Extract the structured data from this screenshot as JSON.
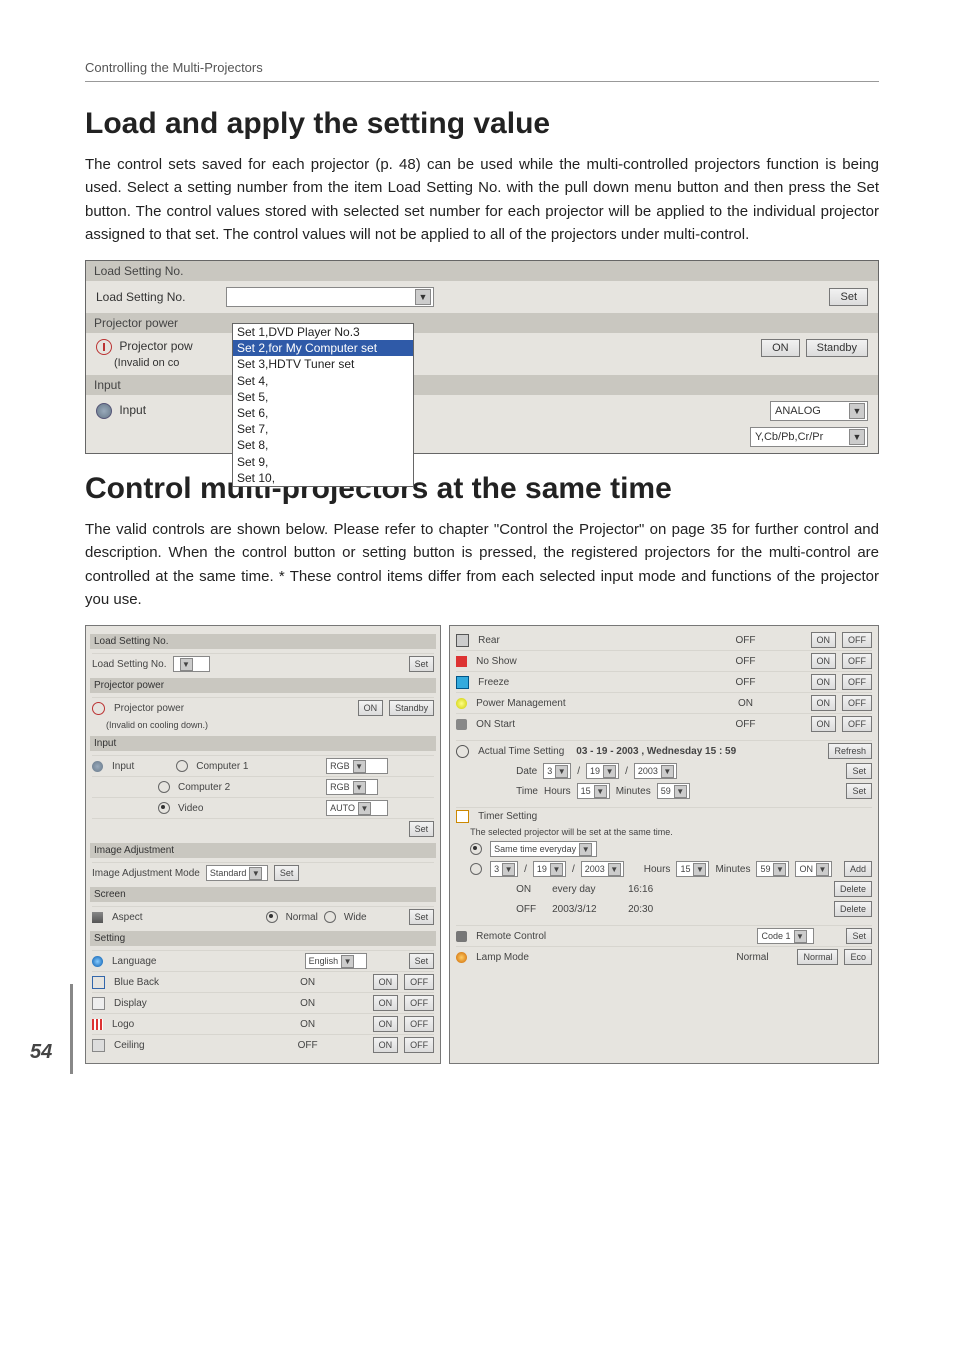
{
  "page": {
    "running_head": "Controlling the Multi-Projectors",
    "number": "54"
  },
  "section1": {
    "title": "Load and apply the setting value",
    "para": "The control sets saved for each projector (p. 48) can be used while the multi-controlled projectors function is being used. Select a setting number from the item Load Setting No. with the pull down menu button and then press the Set button. The control values stored with selected set number for each projector will be applied to the individual projector assigned to that set. The control values will not be applied to all of the projectors under multi-control."
  },
  "shot1": {
    "hdr": "Load Setting No.",
    "label_load": "Load Setting No.",
    "btn_set": "Set",
    "row_pp_hdr": "Projector power",
    "row_pp_label": "Projector pow",
    "pp_note": "(Invalid on co",
    "btn_on": "ON",
    "btn_standby": "Standby",
    "hdr_input": "Input",
    "label_input": "Input",
    "analog": "ANALOG",
    "ycbcr": "Y,Cb/Pb,Cr/Pr",
    "options": [
      "Set 1,DVD Player No.3",
      "Set 2,for My Computer set",
      "Set 3,HDTV Tuner set",
      "Set 4,",
      "Set 5,",
      "Set 6,",
      "Set 7,",
      "Set 8,",
      "Set 9,",
      "Set 10,"
    ]
  },
  "section2": {
    "title": "Control multi-projectors at the same time",
    "para": "The valid controls are shown below. Please refer to chapter \"Control the Projector\" on page 35 for further control and description. When the control button or setting button is pressed, the registered projectors for the multi-control are controlled at the same time. * These control items differ from each selected input mode and functions of the projector you use."
  },
  "left": {
    "hdr_load": "Load Setting No.",
    "lbl_load": "Load Setting No.",
    "btn_set": "Set",
    "hdr_pp": "Projector power",
    "lbl_pp": "Projector power",
    "note_pp": "(Invalid on cooling down.)",
    "on": "ON",
    "standby": "Standby",
    "hdr_input": "Input",
    "lbl_input": "Input",
    "comp1": "Computer 1",
    "comp2": "Computer 2",
    "video": "Video",
    "rgb": "RGB",
    "auto": "AUTO",
    "hdr_img": "Image Adjustment",
    "lbl_img": "Image Adjustment Mode",
    "img_val": "Standard",
    "hdr_screen": "Screen",
    "lbl_aspect": "Aspect",
    "asp_normal": "Normal",
    "asp_wide": "Wide",
    "hdr_setting": "Setting",
    "lbl_lang": "Language",
    "lang_val": "English",
    "lbl_blue": "Blue Back",
    "lbl_disp": "Display",
    "lbl_logo": "Logo",
    "lbl_ceil": "Ceiling",
    "val_on": "ON",
    "val_off": "OFF",
    "btn_on": "ON",
    "btn_off": "OFF"
  },
  "right": {
    "lbl_rear": "Rear",
    "lbl_noshow": "No Show",
    "lbl_freeze": "Freeze",
    "lbl_pm": "Power Management",
    "lbl_onstart": "ON Start",
    "val_off": "OFF",
    "val_on": "ON",
    "btn_on": "ON",
    "btn_off": "OFF",
    "lbl_ats": "Actual Time Setting",
    "ats_val": "03 - 19 - 2003 , Wednesday 15 : 59",
    "btn_refresh": "Refresh",
    "lbl_date": "Date",
    "d_m": "3",
    "d_d": "19",
    "d_y": "2003",
    "lbl_time": "Time",
    "lbl_hours": "Hours",
    "t_h": "15",
    "lbl_minutes": "Minutes",
    "t_m": "59",
    "btn_set": "Set",
    "lbl_timer": "Timer Setting",
    "timer_note": "The selected projector will be set at the same time.",
    "opt_same": "Same time everyday",
    "add": "Add",
    "del": "Delete",
    "t_on_v": "ON",
    "sched1_a": "ON",
    "sched1_b": "every day",
    "sched1_c": "16:16",
    "sched2_a": "OFF",
    "sched2_b": "2003/3/12",
    "sched2_c": "20:30",
    "lbl_rc": "Remote Control",
    "rc_val": "Code 1",
    "lbl_lamp": "Lamp Mode",
    "lamp_val": "Normal",
    "btn_normal": "Normal",
    "btn_eco": "Eco"
  }
}
